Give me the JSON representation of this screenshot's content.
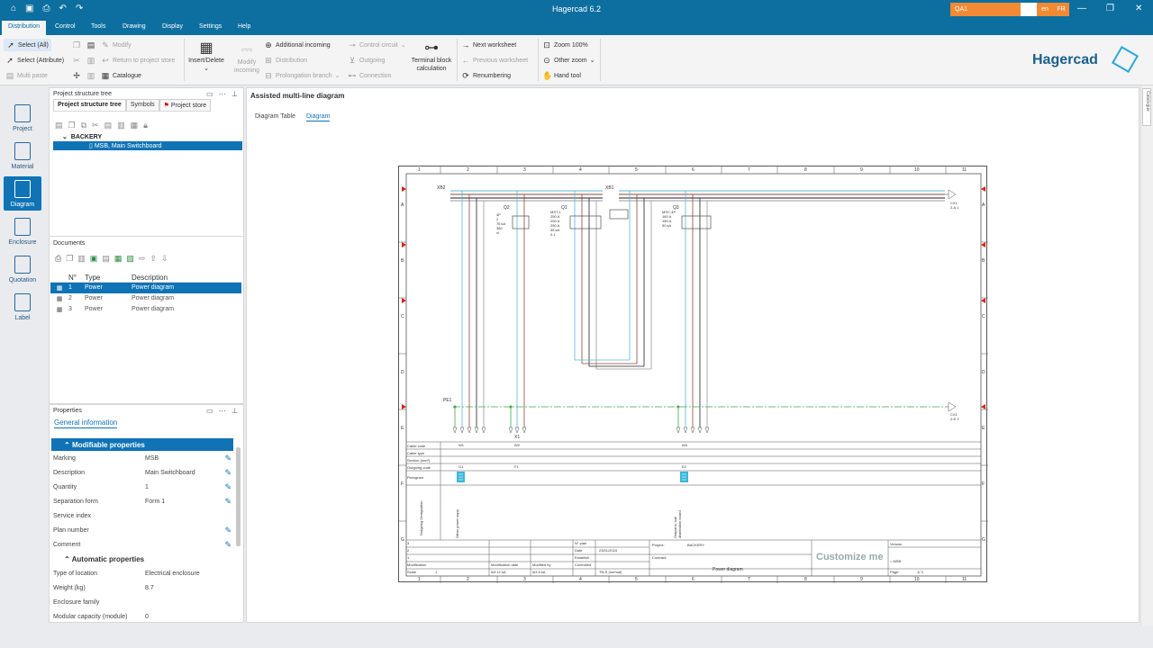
{
  "window": {
    "title": "Hagercad 6.2",
    "qa_field": "QA1",
    "lang1": "en",
    "lang2": "FR"
  },
  "menu": [
    "Distribution",
    "Control",
    "Tools",
    "Drawing",
    "Display",
    "Settings",
    "Help"
  ],
  "ribbon": {
    "select_all": "Select (All)",
    "select_attr": "Select (Attribute)",
    "multi_paste": "Multi paste",
    "modify": "Modify",
    "return_store": "Return to project store",
    "catalogue": "Catalogue",
    "insert_delete": "Insert/Delete",
    "modify_incoming": "Modify incoming",
    "additional_incoming": "Additional incoming",
    "distribution": "Distribution",
    "prolongation": "Prolongation branch",
    "control_circuit": "Control circuit",
    "outgoing": "Outgoing",
    "connection": "Connection",
    "terminal_block": "Terminal block calculation",
    "next_ws": "Next worksheet",
    "prev_ws": "Previous worksheet",
    "renumbering": "Renumbering",
    "zoom100": "Zoom 100%",
    "other_zoom": "Other zoom",
    "hand_tool": "Hand tool",
    "brand": "Hagercad"
  },
  "sidebar": [
    {
      "label": "Project"
    },
    {
      "label": "Material"
    },
    {
      "label": "Diagram"
    },
    {
      "label": "Enclosure"
    },
    {
      "label": "Quotation"
    },
    {
      "label": "Label"
    }
  ],
  "tree_panel": {
    "header": "Project structure tree",
    "tabs": [
      "Project structure tree",
      "Symbols",
      "Project store"
    ],
    "root": "BACKERY",
    "selected": "MSB, Main Switchboard"
  },
  "documents": {
    "header": "Documents",
    "columns": [
      "N°",
      "Type",
      "Description"
    ],
    "rows": [
      {
        "n": "1",
        "type": "Power",
        "desc": "Power diagram"
      },
      {
        "n": "2",
        "type": "Power",
        "desc": "Power diagram"
      },
      {
        "n": "3",
        "type": "Power",
        "desc": "Power diagram"
      }
    ]
  },
  "properties": {
    "header": "Properties",
    "tab": "General information",
    "sec1": "Modifiable properties",
    "rows1": [
      {
        "k": "Marking",
        "v": "MSB"
      },
      {
        "k": "Description",
        "v": "Main Switchboard"
      },
      {
        "k": "Quantity",
        "v": "1"
      },
      {
        "k": "Separation form",
        "v": "Form 1"
      },
      {
        "k": "Service index",
        "v": ""
      },
      {
        "k": "Plan number",
        "v": ""
      },
      {
        "k": "Comment",
        "v": ""
      }
    ],
    "sec2": "Automatic properties",
    "rows2": [
      {
        "k": "Type of location",
        "v": "Electrical enclosure"
      },
      {
        "k": "Weight (kg)",
        "v": "8.7"
      },
      {
        "k": "Enclosure family",
        "v": ""
      },
      {
        "k": "Modular capacity (module)",
        "v": "0"
      }
    ]
  },
  "main": {
    "header": "Assisted multi-line diagram",
    "tabs": [
      "Diagram Table",
      "Diagram"
    ],
    "right_tab": "Catalogue"
  },
  "diagram": {
    "cols": [
      "1",
      "2",
      "3",
      "4",
      "5",
      "6",
      "7",
      "8",
      "9",
      "10",
      "11"
    ],
    "rows": [
      "A",
      "B",
      "C",
      "D",
      "E",
      "F",
      "G"
    ],
    "labels": {
      "xb2": "XB2",
      "xb1": "XB1",
      "pe1": "PE1",
      "q2": "Q2",
      "q1": "Q1",
      "q3": "Q3",
      "x1": "X1",
      "q2_specs": "4P\n2\n76 kA\n380\nvi",
      "q1_specs": "MST-1\n250 A\n250 A\n250 A\n35 kA\n0.1",
      "q3_specs": "MSC-4P\n160 A\n160 A\n50 kA",
      "cx1": "CX1\n2-A.1",
      "cx2": "CX1\n2-E.1",
      "w1": "W1",
      "w2": "W2",
      "w3": "W3",
      "g1": "G1",
      "f1": "F1",
      "e2": "E2",
      "cable_code": "Cable code",
      "cable_type": "Cable type",
      "section": "Section (mm²)",
      "outgoing_code": "Outgoing code",
      "pictogram": "Pictogram",
      "outgoing_desig": "Outgoing Designation",
      "other_power": "Other power supp.",
      "output_sub": "Output to sub distribution board",
      "tb_plan": "N° plan",
      "tb_date": "Date",
      "tb_date_v": "23/01/2024",
      "tb_establish": "Establish",
      "tb_controlled": "Controlled",
      "tb_tn": "TN-S (normal)",
      "tb_project": "Project:",
      "tb_project_v": "BACKERY",
      "tb_contract": "Contract:",
      "tb_doc": "Power diagram",
      "tb_customize": "Customize me",
      "tb_version": "Version",
      "tb_msb": "= MSB",
      "tb_page": "Page:",
      "tb_page_v": "1/ 3",
      "tb_modif": "Modification",
      "tb_scale": "Scale",
      "tb_scale_v": "1",
      "tb_moddate": "Modification date",
      "tb_modby": "Modified by",
      "tb_3": "3",
      "tb_2": "2",
      "tb_1": "1",
      "tb_ik": "Ik3 12 kA",
      "tb_ik2": "Ik3 8 kA"
    }
  }
}
